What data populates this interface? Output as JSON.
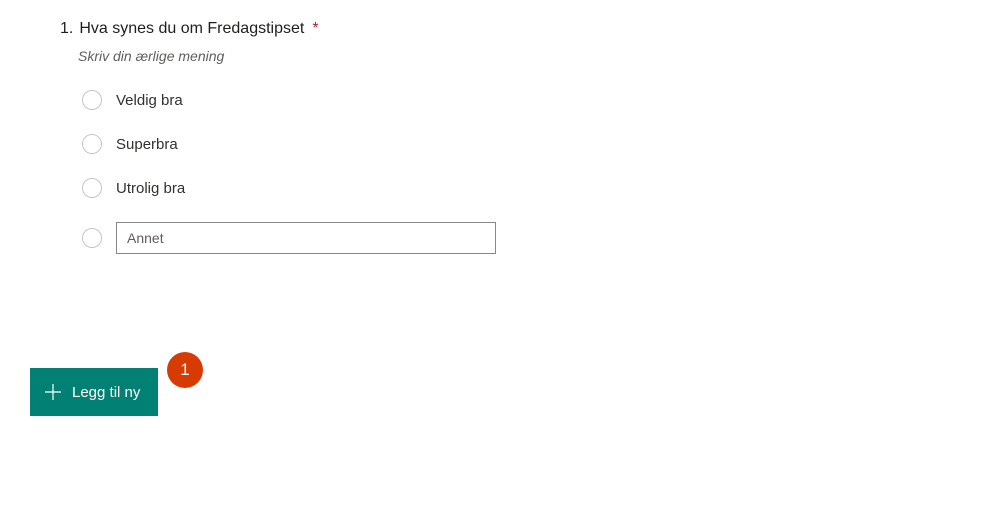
{
  "question": {
    "number": "1.",
    "title": "Hva synes du om Fredagstipset",
    "required_mark": "*",
    "subtitle": "Skriv din ærlige mening",
    "options": [
      "Veldig bra",
      "Superbra",
      "Utrolig bra"
    ],
    "other_value": "Annet"
  },
  "add_button": {
    "label": "Legg til ny"
  },
  "badge": {
    "value": "1"
  }
}
